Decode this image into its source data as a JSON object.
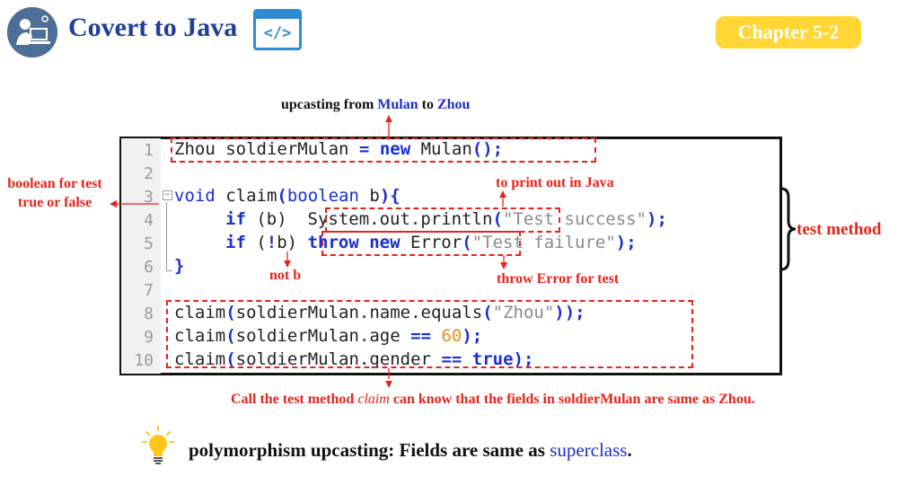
{
  "header": {
    "title": "Covert to Java",
    "code_icon_text": "</>",
    "chapter": "Chapter 5-2"
  },
  "annotations": {
    "upcasting_pre": "upcasting from ",
    "upcasting_from": "Mulan",
    "upcasting_mid": " to ",
    "upcasting_to": "Zhou",
    "boolean_line1": "boolean for test",
    "boolean_line2": "true or false",
    "print_out": "to print out in Java",
    "not_b": "not b",
    "throw_error": "throw Error for test",
    "test_method": "test method",
    "call_pre": "Call the test method ",
    "call_claim": "claim",
    "call_post": " can know that the fields in soldierMulan are same as Zhou."
  },
  "code": {
    "line_numbers": [
      "1",
      "2",
      "3",
      "4",
      "5",
      "6",
      "7",
      "8",
      "9",
      "10"
    ],
    "l1": {
      "a": "Zhou soldierMulan ",
      "eq": "=",
      "sp": " ",
      "new": "new",
      "b": " Mulan",
      "paren": "();"
    },
    "l3": {
      "void": "void",
      "a": " claim",
      "p1": "(",
      "boolean": "boolean",
      "b": " b",
      "p2": "){"
    },
    "l4": {
      "if": "if",
      "a": " (b)  ",
      "println": "System.out.println",
      "p1": "(",
      "str": "\"Test success\"",
      "p2": ");"
    },
    "l5": {
      "if": "if",
      "a": " (",
      "not": "!",
      "b": "b) ",
      "throw": "throw",
      "sp": " ",
      "new": "new",
      "error": " Error",
      "p1": "(",
      "str": "\"Test failure\"",
      "p2": ");"
    },
    "l6": {
      "brace": "}"
    },
    "l8": {
      "a": "claim",
      "p1": "(",
      "b": "soldierMulan.name.equals",
      "p2": "(",
      "str": "\"Zhou\"",
      "p3": "));"
    },
    "l9": {
      "a": "claim",
      "p1": "(",
      "b": "soldierMulan.age ",
      "eq": "==",
      "sp": " ",
      "num": "60",
      "p2": ");"
    },
    "l10": {
      "a": "claim",
      "p1": "(",
      "b": "soldierMulan.gender ",
      "eq": "==",
      "sp": " ",
      "true": "true",
      "p2": ");"
    }
  },
  "footer": {
    "bold_text": "polymorphism upcasting: Fields are same as ",
    "superclass": "superclass",
    "period": "."
  },
  "colors": {
    "title": "#1f3f9a",
    "chapter_bg": "#ffd633",
    "annotation_red": "#e8231b",
    "keyword_blue": "#1a2fcf",
    "number_orange": "#f08c1a",
    "string_gray": "#8a8a8a",
    "bulb": "#ffc61a"
  }
}
